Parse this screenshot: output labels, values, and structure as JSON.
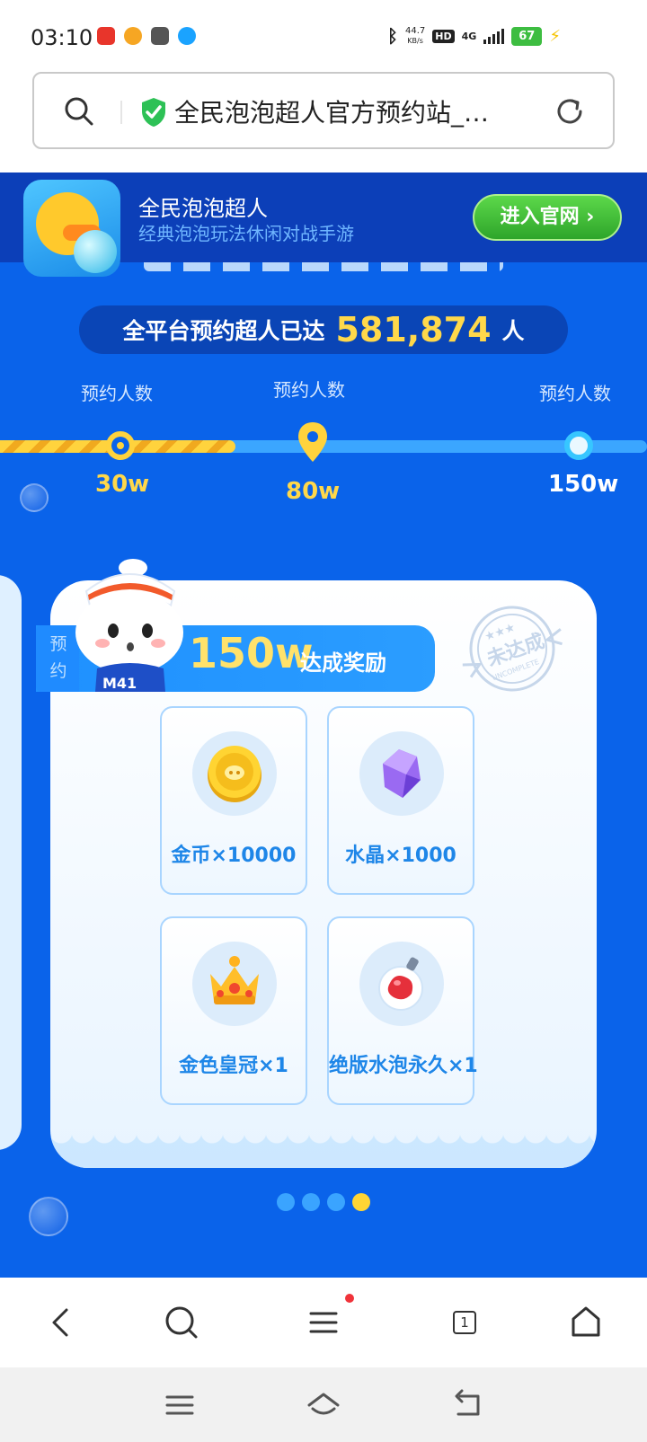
{
  "status_bar": {
    "time": "03:10",
    "net_speed_value": "44.7",
    "net_speed_unit": "KB/s",
    "hd_badge": "HD",
    "network": "4G",
    "battery": "67",
    "notification_colors": [
      "#e8352b",
      "#f6a623",
      "#555555",
      "#1aa3ff"
    ]
  },
  "address_bar": {
    "url_title": "全民泡泡超人官方预约站_…",
    "secure_icon": "shield-check-icon",
    "search_icon": "search-icon",
    "reload_icon": "reload-icon"
  },
  "app_banner": {
    "name": "全民泡泡超人",
    "description": "经典泡泡玩法休闲对战手游",
    "button_label": "进入官网 ›"
  },
  "reservation": {
    "label": "全平台预约超人已达",
    "count": "581,874",
    "unit": "人"
  },
  "milestones": [
    {
      "label": "预约人数",
      "value": "30w",
      "state": "reached"
    },
    {
      "label": "预约人数",
      "value": "80w",
      "state": "current"
    },
    {
      "label": "预约人数",
      "value": "150w",
      "state": "locked"
    }
  ],
  "progress_fraction": 0.36,
  "reward_card": {
    "side_label": "预约",
    "milestone": "150w",
    "title": "达成奖励",
    "stamp_text": "未达成",
    "stamp_subtext": "UNCOMPLETE",
    "items": [
      {
        "label": "金币×10000",
        "icon": "gold-coin-icon"
      },
      {
        "label": "水晶×1000",
        "icon": "crystal-icon"
      },
      {
        "label": "金色皇冠×1",
        "icon": "crown-icon"
      },
      {
        "label": "绝版水泡永久×1",
        "icon": "water-bomb-icon"
      }
    ]
  },
  "carousel": {
    "count": 4,
    "active_index": 3
  },
  "toolbar": {
    "tab_count": "1"
  },
  "colors": {
    "page_blue": "#0a63ea",
    "banner_navy": "#0c3fb8",
    "accent_yellow": "#ffd84a",
    "button_green": "#3cbf34"
  }
}
